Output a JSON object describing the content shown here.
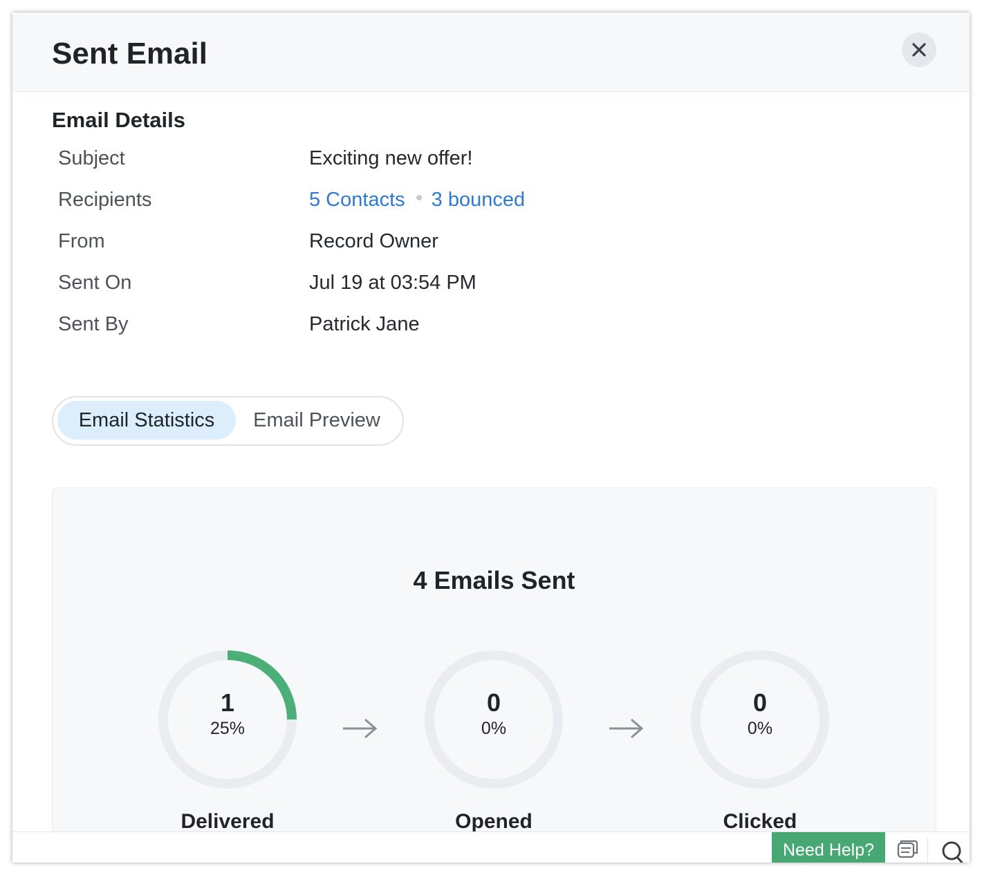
{
  "modal": {
    "title": "Sent Email"
  },
  "details": {
    "section_title": "Email Details",
    "rows": [
      {
        "label": "Subject",
        "value": "Exciting new offer!"
      },
      {
        "label": "Recipients",
        "contacts_link": "5 Contacts",
        "bounced_link": "3 bounced"
      },
      {
        "label": "From",
        "value": "Record Owner"
      },
      {
        "label": "Sent On",
        "value": "Jul 19 at 03:54 PM"
      },
      {
        "label": "Sent By",
        "value": "Patrick Jane"
      }
    ]
  },
  "tabs": [
    {
      "label": "Email Statistics",
      "active": true
    },
    {
      "label": "Email Preview",
      "active": false
    }
  ],
  "stats": {
    "title": "4 Emails Sent",
    "items": [
      {
        "value": "1",
        "percent": "25%",
        "label": "Delivered",
        "fraction": 0.25
      },
      {
        "value": "0",
        "percent": "0%",
        "label": "Opened",
        "fraction": 0
      },
      {
        "value": "0",
        "percent": "0%",
        "label": "Clicked",
        "fraction": 0
      }
    ],
    "ring_color": "#4caf78",
    "ring_track_color": "#e9ecf0"
  },
  "footer": {
    "need_help_label": "Need Help?",
    "icons": [
      "chat-icon",
      "search-icon"
    ]
  },
  "colors": {
    "link": "#2f7ad1",
    "active_tab_bg": "#dcedfc",
    "help_button": "#47a874"
  }
}
